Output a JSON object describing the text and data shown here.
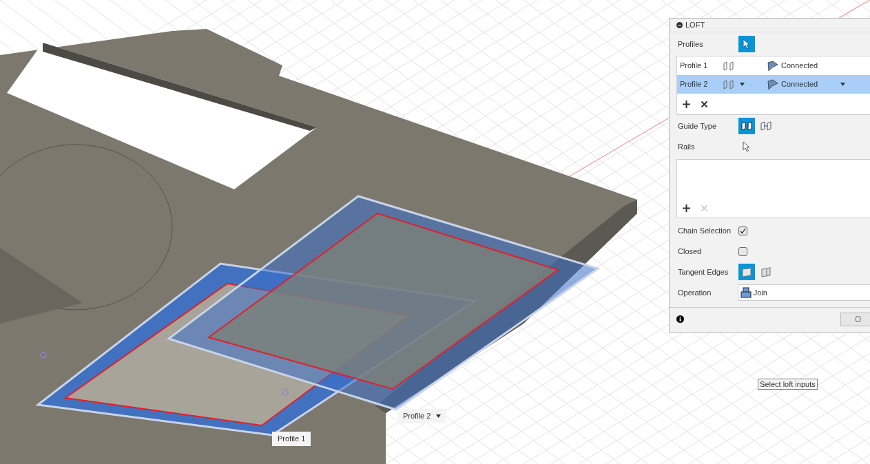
{
  "viewport": {
    "labels": [
      {
        "text": "Profile 2",
        "dropdown": true
      },
      {
        "text": "Profile 1",
        "dropdown": false
      }
    ],
    "tooltip": "Select loft inputs"
  },
  "panel": {
    "title": "LOFT",
    "profiles_label": "Profiles",
    "profiles": [
      {
        "name": "Profile 1",
        "condition": "Connected",
        "selected": false
      },
      {
        "name": "Profile 2",
        "condition": "Connected",
        "selected": true
      }
    ],
    "guide_type_label": "Guide Type",
    "guide_types": [
      {
        "selected": true
      },
      {
        "selected": false
      }
    ],
    "rails_label": "Rails",
    "rails_remove_disabled": true,
    "options": [
      {
        "kind": "checkbox",
        "label": "Chain Selection",
        "checked": true
      },
      {
        "kind": "checkbox",
        "label": "Closed",
        "checked": false
      },
      {
        "kind": "toggle",
        "label": "Tangent Edges",
        "choices": [
          {
            "selected": true
          },
          {
            "selected": false
          }
        ]
      },
      {
        "kind": "dropdown",
        "label": "Operation",
        "value": "Join"
      }
    ],
    "ok_button": "O"
  }
}
